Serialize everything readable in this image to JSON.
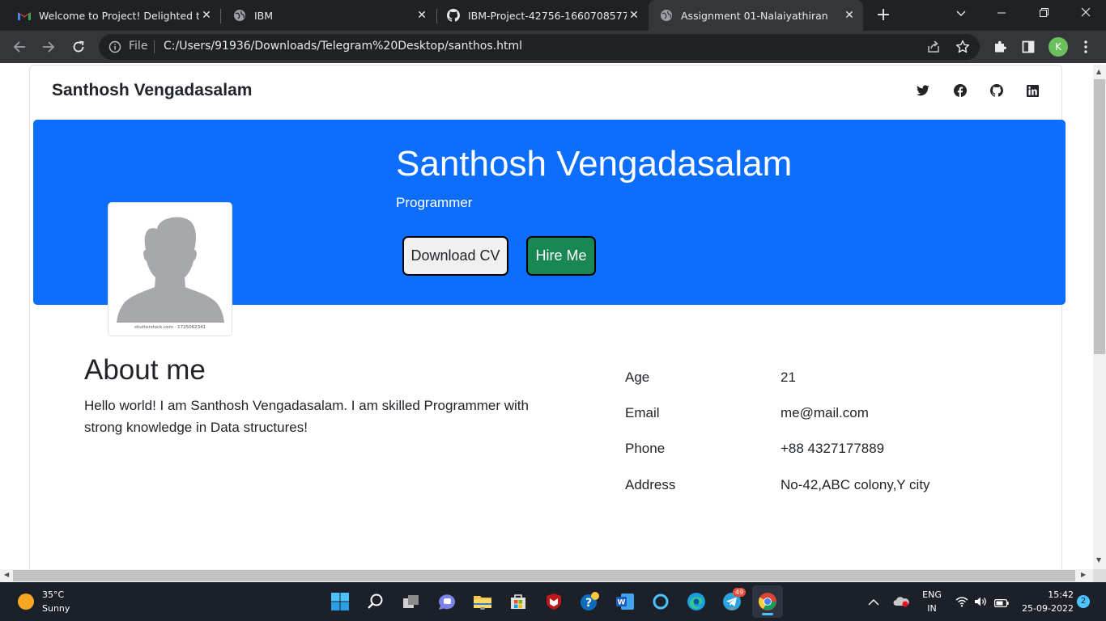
{
  "browser": {
    "tabs": [
      {
        "title": "Welcome to Project! Delighted to",
        "favicon": "gmail-icon"
      },
      {
        "title": "IBM",
        "favicon": "globe-icon"
      },
      {
        "title": "IBM-Project-42756-1660708577",
        "favicon": "github-icon"
      },
      {
        "title": "Assignment 01-Nalaiyathiran",
        "favicon": "globe-icon",
        "active": true
      }
    ],
    "omnibox": {
      "scheme_label": "File",
      "url": "C:/Users/91936/Downloads/Telegram%20Desktop/santhos.html"
    },
    "profile_initial": "K"
  },
  "page": {
    "brand": "Santhosh Vengadasalam",
    "social_icons": [
      "twitter-icon",
      "facebook-icon",
      "github-icon",
      "linkedin-icon"
    ],
    "hero": {
      "name": "Santhosh Vengadasalam",
      "role": "Programmer",
      "download_cv_label": "Download CV",
      "hire_me_label": "Hire Me",
      "background_color": "#0d6efd",
      "hire_color": "#198754"
    },
    "photo_caption": "shutterstock.com · 1725062341",
    "about": {
      "heading": "About me",
      "text": "Hello world! I am Santhosh Vengadasalam. I am skilled Programmer with strong knowledge in Data structures!"
    },
    "info": [
      {
        "key": "Age",
        "value": "21"
      },
      {
        "key": "Email",
        "value": "me@mail.com"
      },
      {
        "key": "Phone",
        "value": "+88 4327177889"
      },
      {
        "key": "Address",
        "value": "No-42,ABC colony,Y city"
      }
    ]
  },
  "taskbar": {
    "weather": {
      "temp": "35°C",
      "condition": "Sunny"
    },
    "telegram_badge": "49",
    "language": {
      "line1": "ENG",
      "line2": "IN"
    },
    "time": "15:42",
    "date": "25-09-2022",
    "notifications": "2"
  }
}
